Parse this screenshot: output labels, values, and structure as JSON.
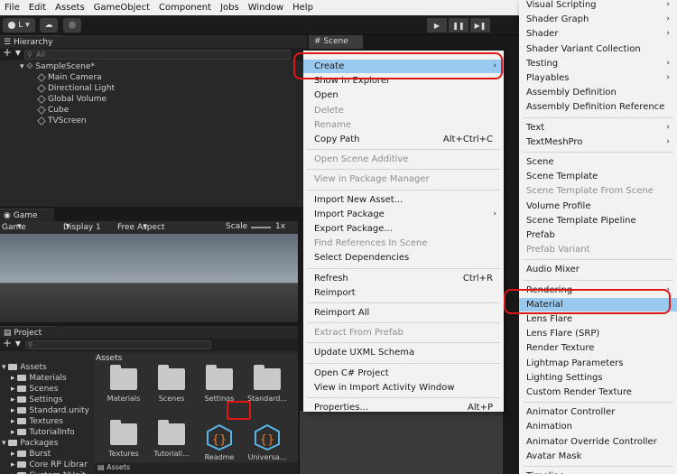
{
  "menubar": [
    "File",
    "Edit",
    "Assets",
    "GameObject",
    "Component",
    "Jobs",
    "Window",
    "Help"
  ],
  "toolbar": {
    "account": "L",
    "play_symbol": "▶",
    "pause_symbol": "❚❚",
    "step_symbol": "▶❚"
  },
  "hierarchy": {
    "tab": "Hierarchy",
    "search_placeholder": "All",
    "scene": "SampleScene*",
    "items": [
      "Main Camera",
      "Directional Light",
      "Global Volume",
      "Cube",
      "TVScreen"
    ]
  },
  "scene_tab": "Scene",
  "game": {
    "tab": "Game",
    "display_left": "Game",
    "display": "Display 1",
    "aspect": "Free Aspect",
    "scale_label": "Scale",
    "scale_value": "1x"
  },
  "project": {
    "tab": "Project",
    "tree": [
      {
        "label": "Assets",
        "level": 0
      },
      {
        "label": "Materials",
        "level": 1
      },
      {
        "label": "Scenes",
        "level": 1
      },
      {
        "label": "Settings",
        "level": 1
      },
      {
        "label": "Standard.unity",
        "level": 1
      },
      {
        "label": "Textures",
        "level": 1
      },
      {
        "label": "TutorialInfo",
        "level": 1
      },
      {
        "label": "Packages",
        "level": 0
      },
      {
        "label": "Burst",
        "level": 1
      },
      {
        "label": "Core RP Librar",
        "level": 1
      },
      {
        "label": "Custom NUnit",
        "level": 1
      }
    ],
    "grid_header": "Assets",
    "assets": [
      "Materials",
      "Scenes",
      "Settings",
      "Standard...",
      "Textures",
      "Tutoriall...",
      "Readme",
      "Universa..."
    ],
    "footer_path": "Assets"
  },
  "context_menu": [
    {
      "label": "Create",
      "submenu": true,
      "highlighted": true
    },
    {
      "label": "Show in Explorer"
    },
    {
      "label": "Open"
    },
    {
      "label": "Delete",
      "disabled": true
    },
    {
      "label": "Rename",
      "disabled": true
    },
    {
      "label": "Copy Path",
      "shortcut": "Alt+Ctrl+C"
    },
    {
      "sep": true
    },
    {
      "label": "Open Scene Additive",
      "disabled": true
    },
    {
      "sep": true
    },
    {
      "label": "View in Package Manager",
      "disabled": true
    },
    {
      "sep": true
    },
    {
      "label": "Import New Asset..."
    },
    {
      "label": "Import Package",
      "submenu": true
    },
    {
      "label": "Export Package..."
    },
    {
      "label": "Find References In Scene",
      "disabled": true
    },
    {
      "label": "Select Dependencies"
    },
    {
      "sep": true
    },
    {
      "label": "Refresh",
      "shortcut": "Ctrl+R"
    },
    {
      "label": "Reimport"
    },
    {
      "sep": true
    },
    {
      "label": "Reimport All"
    },
    {
      "sep": true
    },
    {
      "label": "Extract From Prefab",
      "disabled": true
    },
    {
      "sep": true
    },
    {
      "label": "Update UXML Schema"
    },
    {
      "sep": true
    },
    {
      "label": "Open C# Project"
    },
    {
      "label": "View in Import Activity Window"
    },
    {
      "sep": true
    },
    {
      "label": "Properties...",
      "shortcut": "Alt+P"
    }
  ],
  "create_submenu": [
    {
      "label": "Visual Scripting",
      "submenu": true
    },
    {
      "label": "Shader Graph",
      "submenu": true
    },
    {
      "label": "Shader",
      "submenu": true
    },
    {
      "label": "Shader Variant Collection"
    },
    {
      "label": "Testing",
      "submenu": true
    },
    {
      "label": "Playables",
      "submenu": true
    },
    {
      "label": "Assembly Definition"
    },
    {
      "label": "Assembly Definition Reference"
    },
    {
      "sep": true
    },
    {
      "label": "Text",
      "submenu": true
    },
    {
      "label": "TextMeshPro",
      "submenu": true
    },
    {
      "sep": true
    },
    {
      "label": "Scene"
    },
    {
      "label": "Scene Template"
    },
    {
      "label": "Scene Template From Scene",
      "disabled": true
    },
    {
      "label": "Volume Profile"
    },
    {
      "label": "Scene Template Pipeline"
    },
    {
      "label": "Prefab"
    },
    {
      "label": "Prefab Variant",
      "disabled": true
    },
    {
      "sep": true
    },
    {
      "label": "Audio Mixer"
    },
    {
      "sep": true
    },
    {
      "label": "Rendering",
      "submenu": true
    },
    {
      "label": "Material",
      "highlighted": true
    },
    {
      "label": "Lens Flare"
    },
    {
      "label": "Lens Flare (SRP)"
    },
    {
      "label": "Render Texture"
    },
    {
      "label": "Lightmap Parameters"
    },
    {
      "label": "Lighting Settings"
    },
    {
      "label": "Custom Render Texture"
    },
    {
      "sep": true
    },
    {
      "label": "Animator Controller"
    },
    {
      "label": "Animation"
    },
    {
      "label": "Animator Override Controller"
    },
    {
      "label": "Avatar Mask"
    },
    {
      "sep": true
    },
    {
      "label": "Timeline"
    }
  ],
  "colors": {
    "highlight": "#99c9ef",
    "annotation": "#e01515"
  }
}
